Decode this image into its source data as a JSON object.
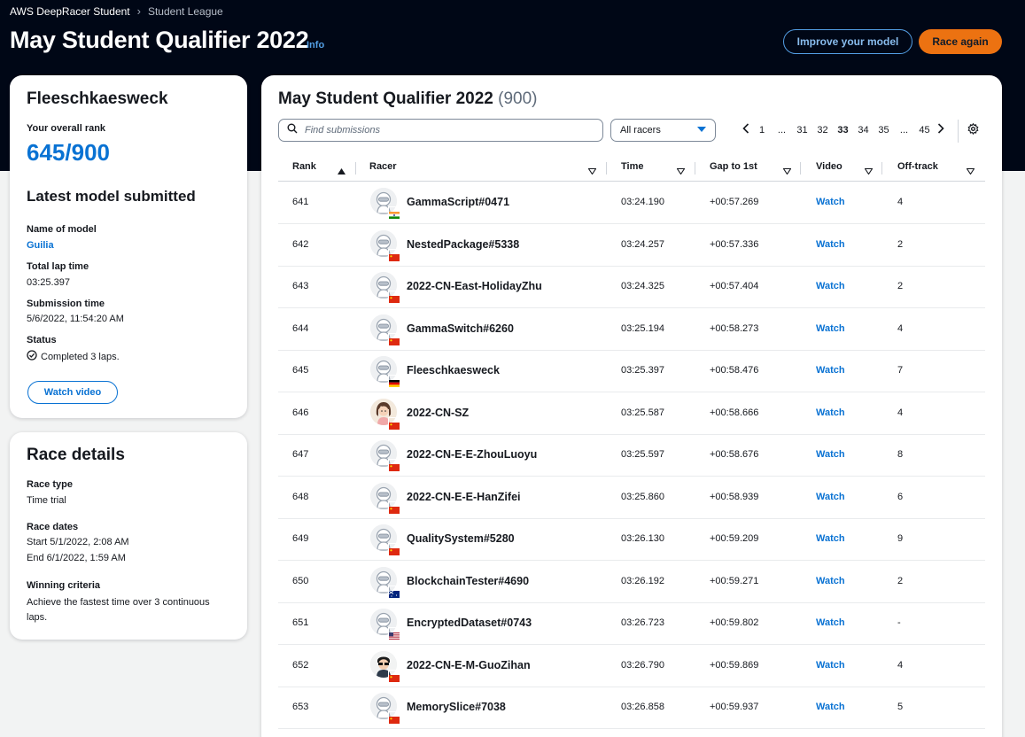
{
  "breadcrumb": {
    "home": "AWS DeepRacer Student",
    "current": "Student League"
  },
  "page": {
    "title": "May Student Qualifier 2022",
    "info": "Info"
  },
  "actions": {
    "improve": "Improve your model",
    "race_again": "Race again"
  },
  "profile": {
    "name": "Fleeschkaesweck",
    "rank_label": "Your overall rank",
    "rank": "645/900",
    "latest_title": "Latest model submitted",
    "model_label": "Name of model",
    "model": "Guilia",
    "laptime_label": "Total lap time",
    "laptime": "03:25.397",
    "subtime_label": "Submission time",
    "subtime": "5/6/2022, 11:54:20 AM",
    "status_label": "Status",
    "status": "Completed 3 laps.",
    "watch_button": "Watch video"
  },
  "race": {
    "title": "Race details",
    "type_label": "Race type",
    "type": "Time trial",
    "dates_label": "Race dates",
    "start": "Start 5/1/2022, 2:08 AM",
    "end": "End 6/1/2022, 1:59 AM",
    "criteria_label": "Winning criteria",
    "criteria": "Achieve the fastest time over 3 continuous laps."
  },
  "leaderboard": {
    "title": "May Student Qualifier 2022",
    "count": "(900)",
    "search_placeholder": "Find submissions",
    "filter": "All racers",
    "pages": [
      "1",
      "...",
      "31",
      "32",
      "33",
      "34",
      "35",
      "...",
      "45"
    ],
    "current_page": "33",
    "columns": {
      "rank": "Rank",
      "racer": "Racer",
      "time": "Time",
      "gap": "Gap to 1st",
      "video": "Video",
      "offtrack": "Off-track"
    },
    "rows": [
      {
        "rank": "641",
        "racer": "GammaScript#0471",
        "time": "03:24.190",
        "gap": "+00:57.269",
        "video": "Watch",
        "offtrack": "4",
        "avatar": "default",
        "flag": "india"
      },
      {
        "rank": "642",
        "racer": "NestedPackage#5338",
        "time": "03:24.257",
        "gap": "+00:57.336",
        "video": "Watch",
        "offtrack": "2",
        "avatar": "default",
        "flag": "china"
      },
      {
        "rank": "643",
        "racer": "2022-CN-East-HolidayZhu",
        "time": "03:24.325",
        "gap": "+00:57.404",
        "video": "Watch",
        "offtrack": "2",
        "avatar": "default",
        "flag": "china"
      },
      {
        "rank": "644",
        "racer": "GammaSwitch#6260",
        "time": "03:25.194",
        "gap": "+00:58.273",
        "video": "Watch",
        "offtrack": "4",
        "avatar": "default",
        "flag": "china"
      },
      {
        "rank": "645",
        "racer": "Fleeschkaesweck",
        "time": "03:25.397",
        "gap": "+00:58.476",
        "video": "Watch",
        "offtrack": "7",
        "avatar": "default",
        "flag": "germany"
      },
      {
        "rank": "646",
        "racer": "2022-CN-SZ",
        "time": "03:25.587",
        "gap": "+00:58.666",
        "video": "Watch",
        "offtrack": "4",
        "avatar": "girl",
        "flag": "china"
      },
      {
        "rank": "647",
        "racer": "2022-CN-E-E-ZhouLuoyu",
        "time": "03:25.597",
        "gap": "+00:58.676",
        "video": "Watch",
        "offtrack": "8",
        "avatar": "default",
        "flag": "china"
      },
      {
        "rank": "648",
        "racer": "2022-CN-E-E-HanZifei",
        "time": "03:25.860",
        "gap": "+00:58.939",
        "video": "Watch",
        "offtrack": "6",
        "avatar": "default",
        "flag": "china"
      },
      {
        "rank": "649",
        "racer": "QualitySystem#5280",
        "time": "03:26.130",
        "gap": "+00:59.209",
        "video": "Watch",
        "offtrack": "9",
        "avatar": "default",
        "flag": "china"
      },
      {
        "rank": "650",
        "racer": "BlockchainTester#4690",
        "time": "03:26.192",
        "gap": "+00:59.271",
        "video": "Watch",
        "offtrack": "2",
        "avatar": "default",
        "flag": "australia"
      },
      {
        "rank": "651",
        "racer": "EncryptedDataset#0743",
        "time": "03:26.723",
        "gap": "+00:59.802",
        "video": "Watch",
        "offtrack": "-",
        "avatar": "default",
        "flag": "usa"
      },
      {
        "rank": "652",
        "racer": "2022-CN-E-M-GuoZihan",
        "time": "03:26.790",
        "gap": "+00:59.869",
        "video": "Watch",
        "offtrack": "4",
        "avatar": "sunglasses",
        "flag": "china"
      },
      {
        "rank": "653",
        "racer": "MemorySlice#7038",
        "time": "03:26.858",
        "gap": "+00:59.937",
        "video": "Watch",
        "offtrack": "5",
        "avatar": "default",
        "flag": "china"
      }
    ]
  },
  "colors": {
    "header_bg": "#000716",
    "accent": "#0972d3",
    "primary_button": "#ec7211"
  }
}
